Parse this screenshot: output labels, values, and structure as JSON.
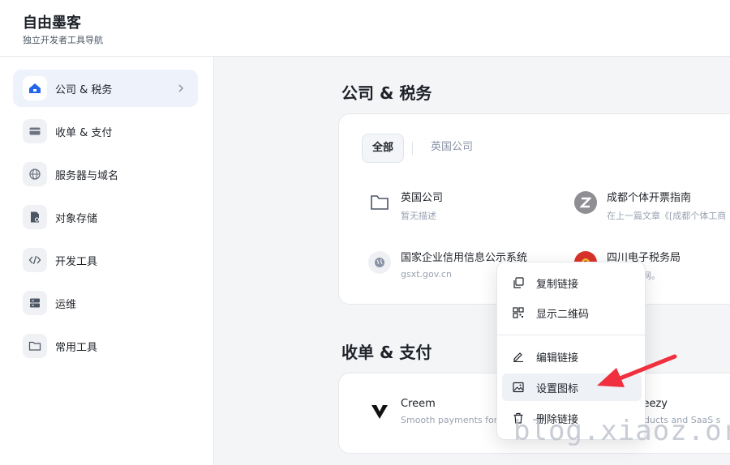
{
  "header": {
    "title": "自由墨客",
    "subtitle": "独立开发者工具导航"
  },
  "sidebar": {
    "items": [
      {
        "label": "公司 & 税务",
        "icon": "building-icon",
        "active": true
      },
      {
        "label": "收单 & 支付",
        "icon": "credit-card-icon",
        "active": false
      },
      {
        "label": "服务器与域名",
        "icon": "globe-icon",
        "active": false
      },
      {
        "label": "对象存储",
        "icon": "file-storage-icon",
        "active": false
      },
      {
        "label": "开发工具",
        "icon": "code-icon",
        "active": false
      },
      {
        "label": "运维",
        "icon": "server-icon",
        "active": false
      },
      {
        "label": "常用工具",
        "icon": "folder-icon",
        "active": false
      }
    ]
  },
  "sections": {
    "company_tax": {
      "title": "公司 & 税务",
      "tabs": [
        "全部",
        "英国公司"
      ],
      "links": [
        {
          "title": "英国公司",
          "desc": "暂无描述",
          "icon": "folder-icon"
        },
        {
          "title": "成都个体开票指南",
          "desc": "在上一篇文章《[成都个体工商",
          "icon": "z-logo-icon"
        },
        {
          "title": "国家企业信用信息公示系统",
          "desc": "gsxt.gov.cn",
          "icon": "globe-icon"
        },
        {
          "title": "四川电子税务局",
          "desc": "税务局官网。",
          "icon": "emblem-icon"
        }
      ]
    },
    "payment": {
      "title": "收单 & 支付",
      "links": [
        {
          "title": "Creem",
          "desc": "Smooth payments for S",
          "icon": "creem-logo-icon"
        },
        {
          "title": "queezy",
          "desc": "products and SaaS s",
          "icon": "lemonsqueezy-logo-icon"
        }
      ]
    }
  },
  "context_menu": {
    "items": [
      {
        "label": "复制链接",
        "icon": "copy-icon"
      },
      {
        "label": "显示二维码",
        "icon": "qrcode-icon"
      },
      {
        "label": "编辑链接",
        "icon": "pencil-icon"
      },
      {
        "label": "设置图标",
        "icon": "image-edit-icon"
      },
      {
        "label": "删除链接",
        "icon": "trash-icon"
      }
    ]
  },
  "watermark": "blog.xiaoz.org",
  "colors": {
    "accent": "#2563eb",
    "active_bg": "#edf2fb",
    "arrow": "#f0303e"
  }
}
